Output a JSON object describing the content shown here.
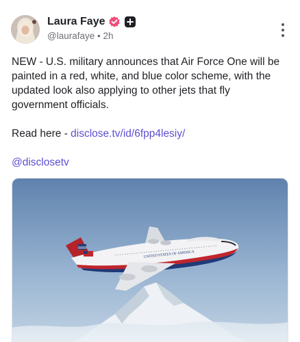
{
  "author": {
    "name": "Laura Faye",
    "handle": "@laurafaye",
    "time": "2h",
    "separator": "•"
  },
  "post": {
    "paragraph": "NEW - U.S. military announces that Air Force One will be painted in a red, white, and blue color scheme, with the updated look also applying to other jets that fly government officials.",
    "read_prefix": "Read here - ",
    "read_link": "disclose.tv/id/6fpp4lesiy/",
    "mention": "@disclosetv"
  },
  "media": {
    "fuselage_text": "UNITED STATES OF AMERICA"
  },
  "colors": {
    "link": "#5b4fd1",
    "verified_badge": "#f04e7a",
    "plus_badge": "#1f1f24"
  },
  "icons": {
    "verified": "verified-badge-icon",
    "plus": "plus-badge-icon",
    "more": "more-vertical-icon"
  }
}
